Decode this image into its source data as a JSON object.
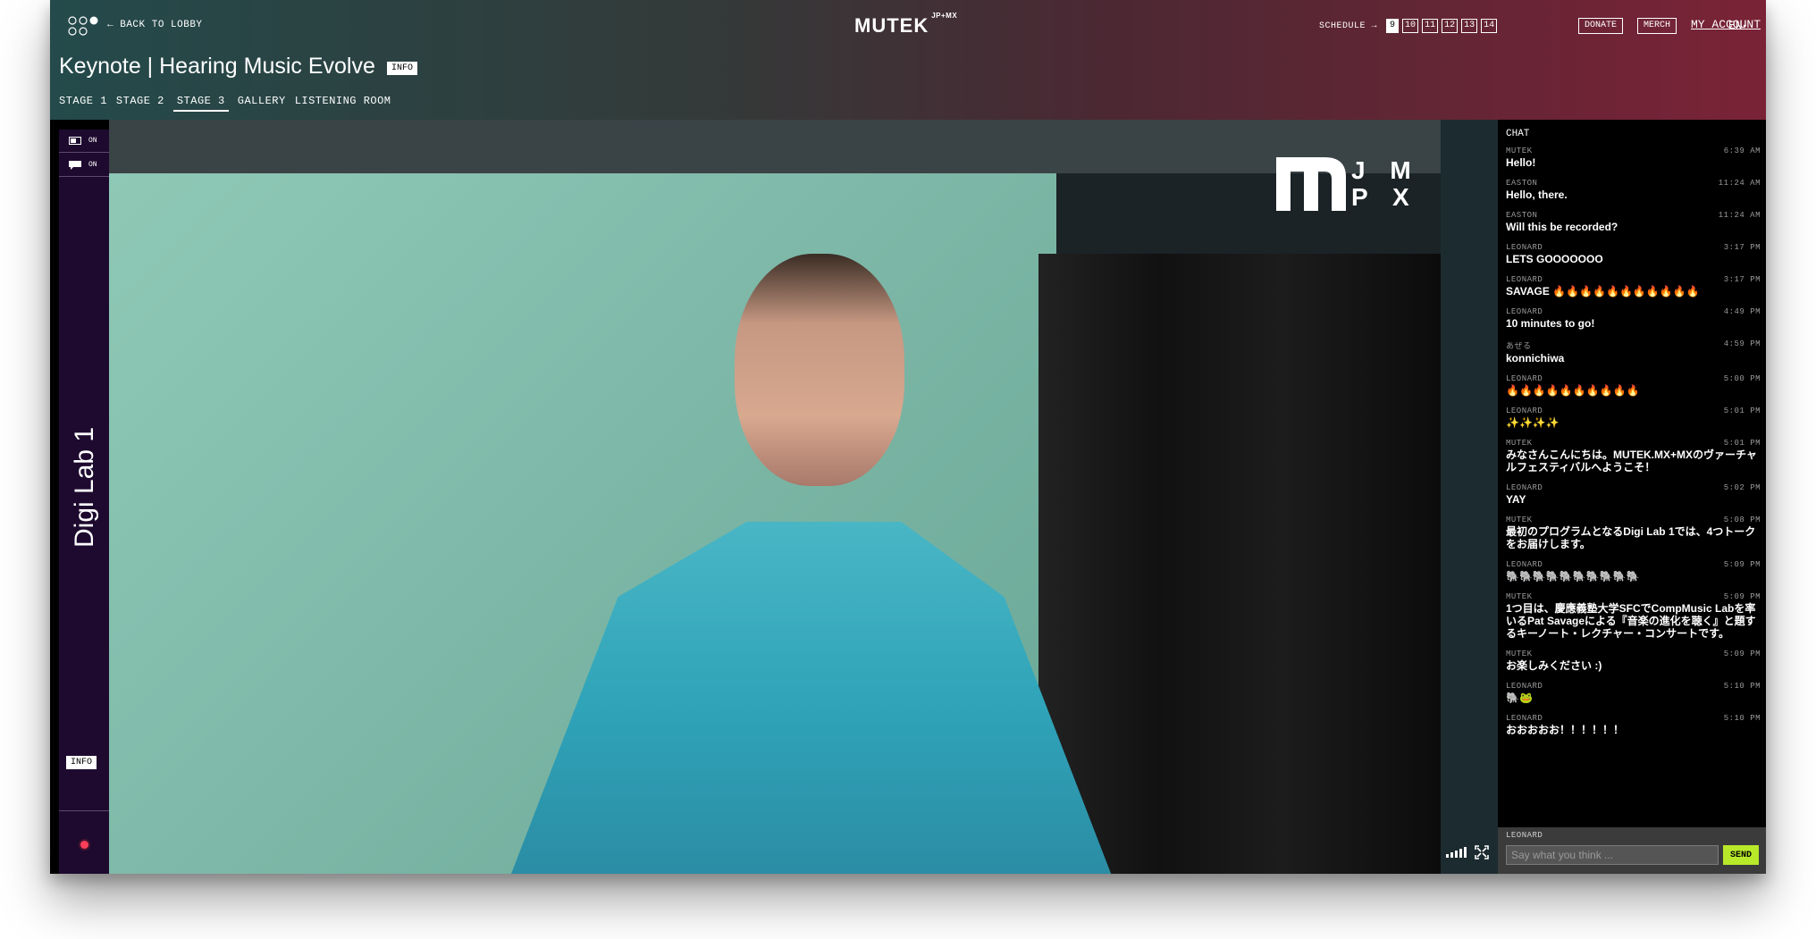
{
  "header": {
    "back_label": "BACK TO LOBBY",
    "brand": "MUTEK",
    "brand_sup": "JP+MX",
    "schedule_label": "SCHEDULE",
    "schedule_days": [
      "9",
      "10",
      "11",
      "12",
      "13",
      "14"
    ],
    "donate_label": "DONATE",
    "merch_label": "MERCH",
    "account_label": "MY ACCOUNT",
    "lang_label": "EN",
    "title": "Keynote | Hearing Music Evolve",
    "info_label": "INFO"
  },
  "stage_tabs": [
    "STAGE 1",
    "STAGE 2",
    "STAGE 3",
    "GALLERY",
    "LISTENING ROOM"
  ],
  "sidebar": {
    "toggle1": "ON",
    "toggle2": "ON",
    "stage_name": "Digi Lab 1",
    "info_label": "INFO"
  },
  "video": {
    "logo_letters": "JMPX"
  },
  "chat": {
    "title": "CHAT",
    "messages": [
      {
        "user": "MUTEK",
        "time": "6:39 AM",
        "text": "Hello!"
      },
      {
        "user": "EASTON",
        "time": "11:24 AM",
        "text": "Hello, there."
      },
      {
        "user": "EASTON",
        "time": "11:24 AM",
        "text": "Will this be recorded?"
      },
      {
        "user": "LEONARD",
        "time": "3:17 PM",
        "text": "LETS GOOOOOOO"
      },
      {
        "user": "LEONARD",
        "time": "3:17 PM",
        "text": "SAVAGE 🔥🔥🔥🔥🔥🔥🔥🔥🔥🔥🔥"
      },
      {
        "user": "LEONARD",
        "time": "4:49 PM",
        "text": "10 minutes to go!"
      },
      {
        "user": "あぜる",
        "time": "4:59 PM",
        "text": "konnichiwa"
      },
      {
        "user": "LEONARD",
        "time": "5:00 PM",
        "text": "🔥🔥🔥🔥🔥🔥🔥🔥🔥🔥"
      },
      {
        "user": "LEONARD",
        "time": "5:01 PM",
        "text": "✨✨✨✨"
      },
      {
        "user": "MUTEK",
        "time": "5:01 PM",
        "text": "みなさんこんにちは。MUTEK.MX+MXのヴァーチャルフェスティバルへようこそ！"
      },
      {
        "user": "LEONARD",
        "time": "5:02 PM",
        "text": "YAY"
      },
      {
        "user": "MUTEK",
        "time": "5:08 PM",
        "text": "最初のプログラムとなるDigi Lab 1では、4つトークをお届けします。"
      },
      {
        "user": "LEONARD",
        "time": "5:09 PM",
        "text": "🐘🐘🐘🐘🐘🐘🐘🐘🐘🐘"
      },
      {
        "user": "MUTEK",
        "time": "5:09 PM",
        "text": "1つ目は、慶應義塾大学SFCでCompMusic Labを率いるPat Savageによる『音楽の進化を聴く』と題するキーノート・レクチャー・コンサートです。"
      },
      {
        "user": "MUTEK",
        "time": "5:09 PM",
        "text": "お楽しみください :)"
      },
      {
        "user": "LEONARD",
        "time": "5:10 PM",
        "text": "🐘🐸"
      },
      {
        "user": "LEONARD",
        "time": "5:10 PM",
        "text": "おおおおお！！！！！！"
      }
    ],
    "input_user": "LEONARD",
    "input_placeholder": "Say what you think ...",
    "send_label": "SEND"
  },
  "colors": {
    "header_left": "#244a4b",
    "header_right": "#7a2336",
    "sidebar_bg": "#1e0a2f",
    "send_button": "#b8e82a",
    "rec_dot": "#ff3f5a"
  },
  "icons": {
    "logo": "dots-logo-icon",
    "back": "arrow-left-icon",
    "schedule_arrow": "arrow-right-icon",
    "lang": "caret-down-icon",
    "camera_toggle": "camera-icon",
    "chat_toggle": "chat-bubble-icon",
    "volume": "volume-bars-icon",
    "fullscreen": "fullscreen-icon",
    "record": "record-dot-icon"
  }
}
